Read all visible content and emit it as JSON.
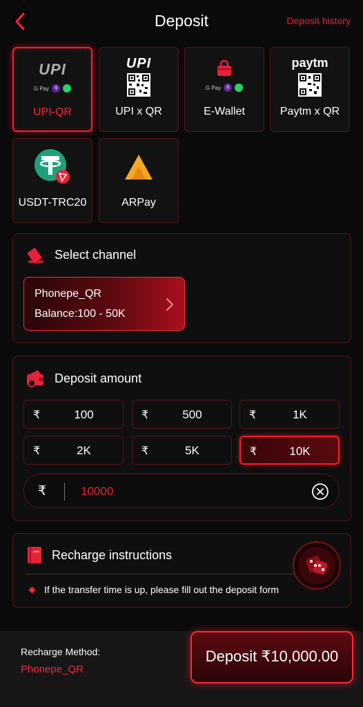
{
  "header": {
    "title": "Deposit",
    "history_label": "Deposit history"
  },
  "methods": [
    {
      "label": "UPI-QR",
      "logo_text": "UPI",
      "active": true
    },
    {
      "label": "UPI x QR",
      "logo_text": "UPI"
    },
    {
      "label": "E-Wallet"
    },
    {
      "label": "Paytm x QR",
      "logo_text": "paytm"
    },
    {
      "label": "USDT-TRC20"
    },
    {
      "label": "ARPay"
    }
  ],
  "pay_badges": {
    "gpay": "G Pay",
    "phonepe": "पे"
  },
  "channel": {
    "title": "Select channel",
    "name": "Phonepe_QR",
    "balance": "Balance:100 - 50K"
  },
  "deposit_amount": {
    "title": "Deposit amount",
    "currency_symbol": "₹",
    "options": [
      "100",
      "500",
      "1K",
      "2K",
      "5K",
      "10K"
    ],
    "selected": "10K",
    "input_value": "10000"
  },
  "instructions": {
    "title": "Recharge instructions",
    "items": [
      "If the transfer time is up, please fill out the deposit form"
    ]
  },
  "footer": {
    "method_label": "Recharge Method:",
    "method_value": "Phonepe_QR",
    "deposit_button": "Deposit ₹10,000.00"
  },
  "colors": {
    "accent": "#ff2436",
    "card_border": "#5a1419",
    "background": "#0a0a0a"
  }
}
